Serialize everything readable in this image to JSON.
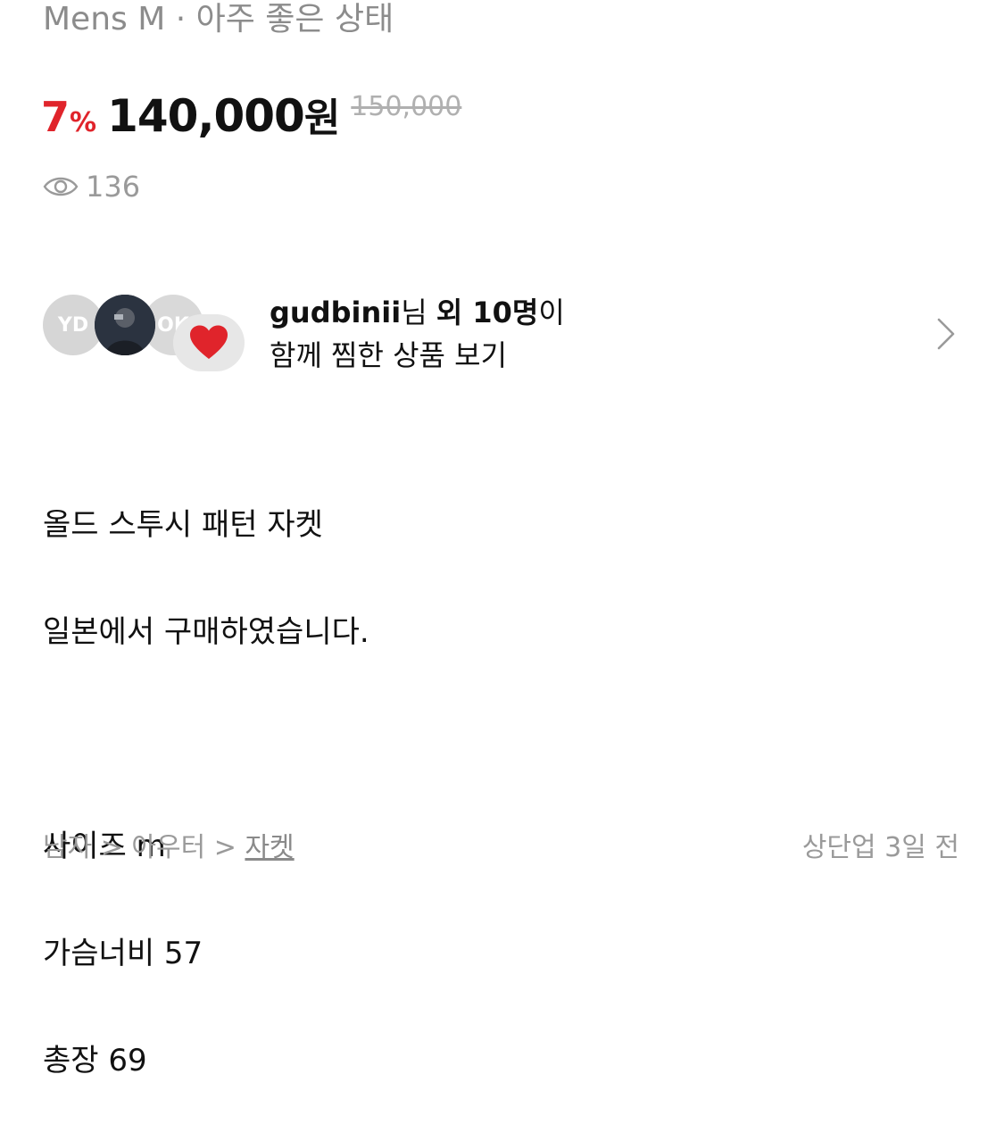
{
  "header": {
    "subtitle": "Mens M · 아주 좋은 상태"
  },
  "price": {
    "discount_value": "7",
    "discount_unit": "%",
    "current": "140,000",
    "current_unit": "원",
    "original": "150,000"
  },
  "stats": {
    "views": "136",
    "views_icon": "eye-icon"
  },
  "likers": {
    "avatars": [
      "YD",
      "OK"
    ],
    "username": "gudbinii",
    "suffix_nim": "님",
    "others": "외 10명",
    "suffix_i": "이",
    "line2": "함께 찜한 상품 보기",
    "heart_icon": "heart-icon",
    "chevron_icon": "chevron-right-icon",
    "heart_color": "#e0242b"
  },
  "description": {
    "lines": [
      "올드 스투시 패턴 자켓",
      "일본에서 구매하였습니다.",
      "",
      "사이즈 m",
      "가슴너비 57",
      "총장 69"
    ]
  },
  "footer": {
    "category": {
      "level1": "남자",
      "separator": " > ",
      "level2": "아우터",
      "level3": "자켓"
    },
    "posted": "상단업 3일 전"
  }
}
